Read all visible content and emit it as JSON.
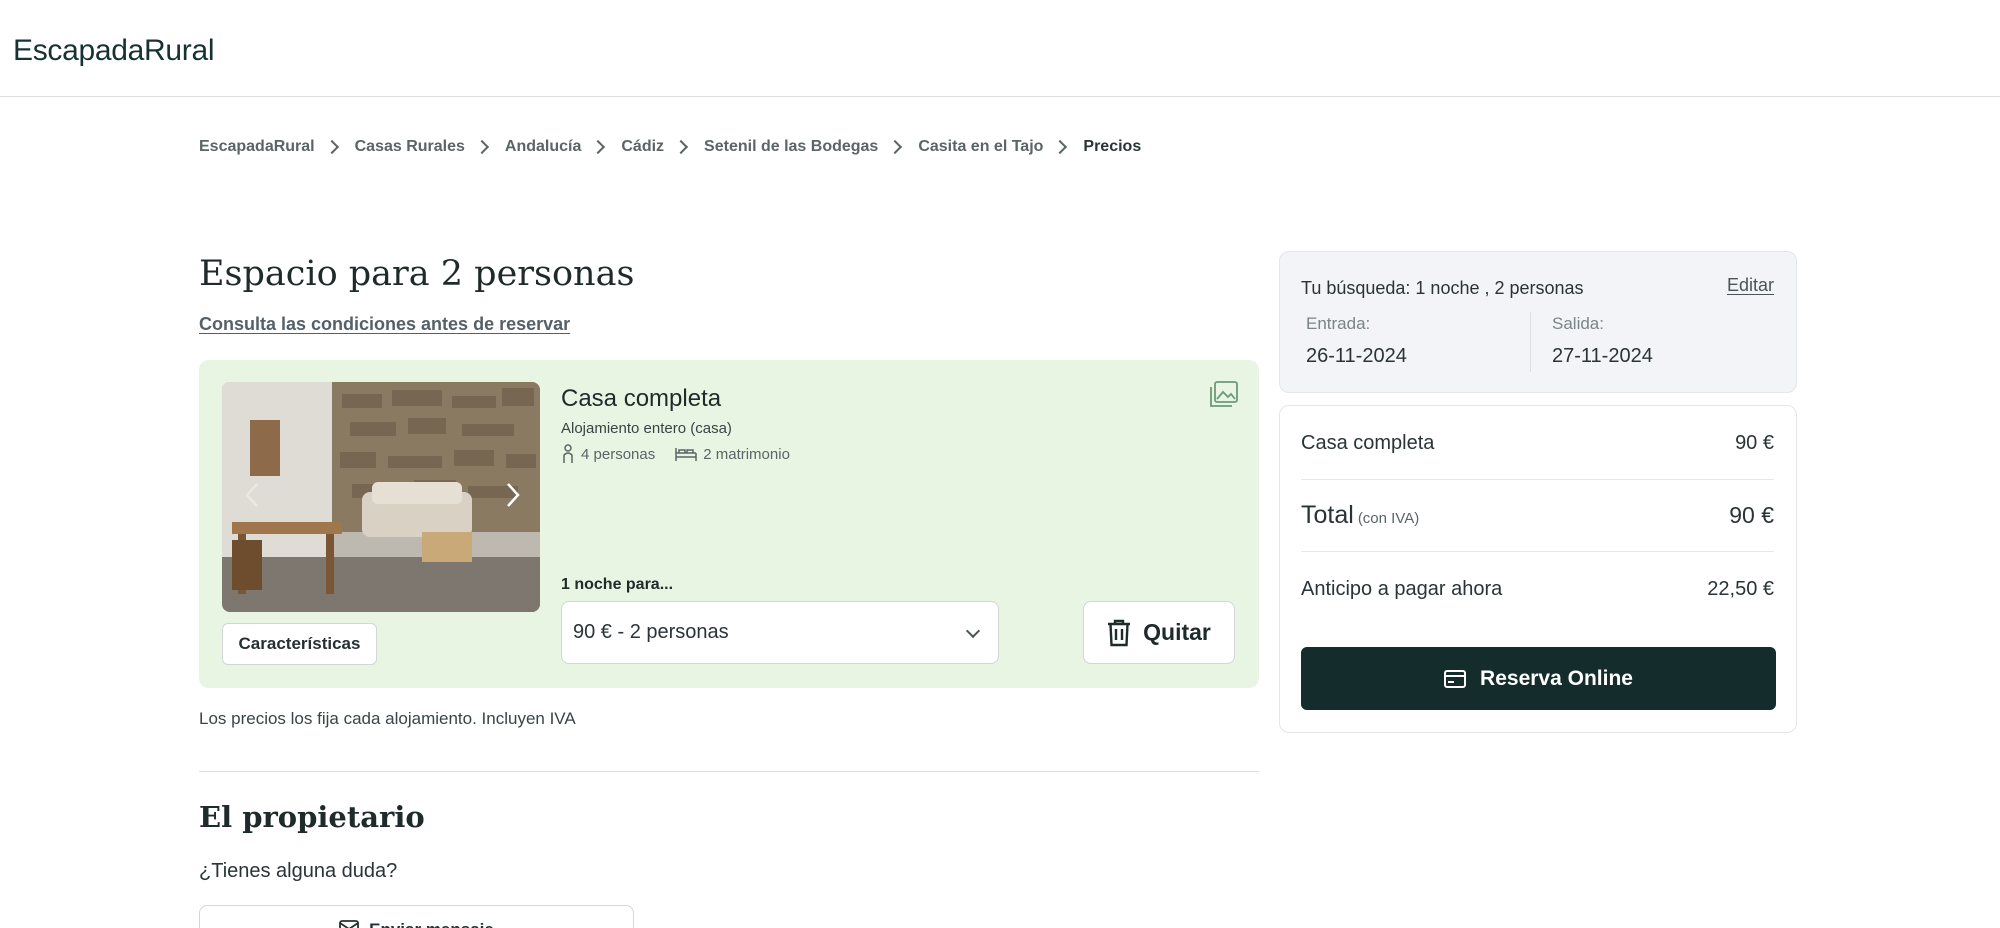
{
  "header": {
    "logo": "EscapadaRural"
  },
  "breadcrumb": {
    "items": [
      "EscapadaRural",
      "Casas Rurales",
      "Andalucía",
      "Cádiz",
      "Setenil de las Bodegas",
      "Casita en el Tajo"
    ],
    "current": "Precios"
  },
  "main": {
    "title": "Espacio para 2 personas",
    "conditions_link": "Consulta las condiciones antes de reservar",
    "room": {
      "name": "Casa completa",
      "type": "Alojamiento entero (casa)",
      "guests": "4 personas",
      "beds": "2 matrimonio",
      "features_label": "Características",
      "nights_label": "1 noche para...",
      "selected_option": "90 € - 2 personas",
      "remove_label": "Quitar",
      "icons": {
        "guests": "person-icon",
        "beds": "bed-icon",
        "gallery": "gallery-icon",
        "remove": "trash-icon"
      }
    },
    "prices_note": "Los precios los fija cada alojamiento. Incluyen IVA",
    "owner": {
      "title": "El propietario",
      "question": "¿Tienes alguna duda?",
      "message_label": "Enviar mensaje"
    }
  },
  "search": {
    "summary": "Tu búsqueda: 1 noche , 2 personas",
    "edit_label": "Editar",
    "checkin_label": "Entrada:",
    "checkin_value": "26-11-2024",
    "checkout_label": "Salida:",
    "checkout_value": "27-11-2024"
  },
  "summary": {
    "item_label": "Casa completa",
    "item_price": "90 €",
    "total_label": "Total",
    "total_note": "(con IVA)",
    "total_price": "90 €",
    "deposit_label": "Anticipo a pagar ahora",
    "deposit_price": "22,50 €",
    "book_label": "Reserva Online"
  },
  "colors": {
    "card_bg": "#e8f5e3",
    "primary_button": "#142c2b",
    "search_bg": "#f3f4f7"
  }
}
